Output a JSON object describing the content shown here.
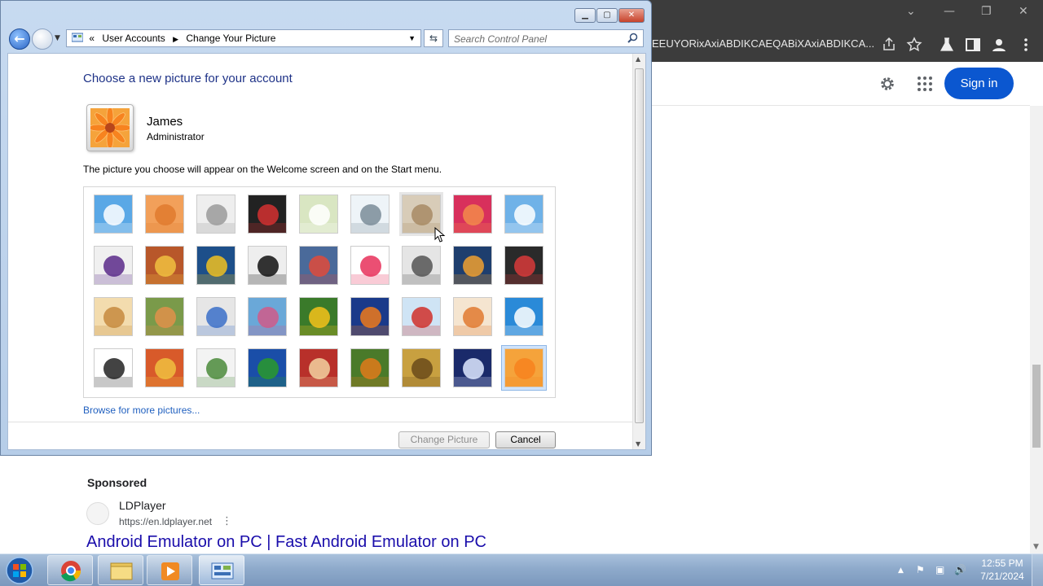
{
  "browser": {
    "address_text": "EEUYORixAxiABDIKCAEQABiXAxiABDIKCA...",
    "sign_in": "Sign in",
    "sponsored": "Sponsored",
    "ad": {
      "site_name": "LDPlayer",
      "url": "https://en.ldplayer.net",
      "title": "Android Emulator on PC | Fast Android Emulator on PC"
    },
    "accent": "#0b57d0"
  },
  "window": {
    "breadcrumb": [
      "User Accounts",
      "Change Your Picture"
    ],
    "search_placeholder": "Search Control Panel",
    "heading": "Choose a new picture for your account",
    "user_name": "James",
    "user_role": "Administrator",
    "hint": "The picture you choose will appear on the Welcome screen and on the Start menu.",
    "browse_link": "Browse for more pictures...",
    "change_picture_button": "Change Picture",
    "cancel_button": "Cancel",
    "pictures": [
      "roller-coaster",
      "starfish",
      "robot-toy",
      "turntable",
      "lucky-cat",
      "satellite-dish",
      "kitten",
      "pink-flower",
      "pinwheel",
      "ball",
      "fabric-stripes",
      "ginkgo-leaf",
      "dog",
      "crayons",
      "pink-star-flower",
      "jacks",
      "stairs",
      "paper-crane",
      "guitar",
      "puppy",
      "robot",
      "scarves",
      "sunflower",
      "fish",
      "hot-air-balloon",
      "doll",
      "sailboat",
      "soccer-ball",
      "fabric",
      "marbles",
      "window",
      "pattern-cloth",
      "butterfly",
      "basket",
      "lighthouse",
      "orange-gerbera"
    ],
    "selected_picture": "orange-gerbera",
    "hovered_picture": "kitten"
  },
  "taskbar": {
    "time": "12:55 PM",
    "date": "7/21/2024"
  }
}
